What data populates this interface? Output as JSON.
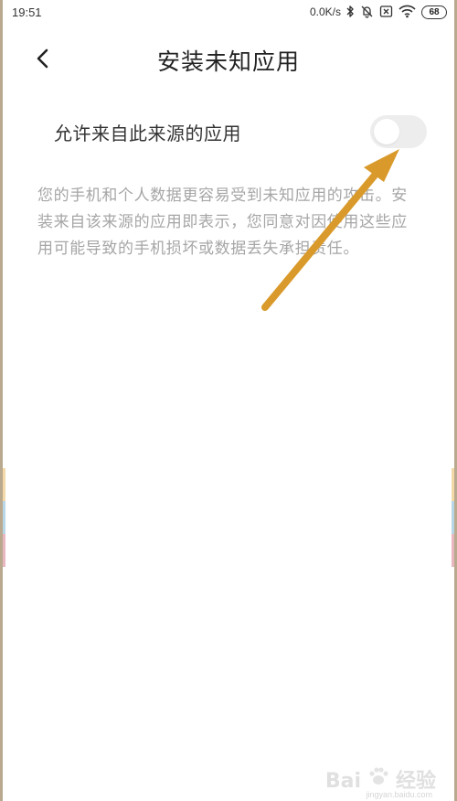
{
  "status_bar": {
    "time": "19:51",
    "network_speed": "0.0K/s",
    "battery": "68",
    "icons": [
      "bluetooth-icon",
      "bell-muted-icon",
      "sim-x-icon",
      "wifi-icon",
      "battery-icon"
    ]
  },
  "header": {
    "title": "安装未知应用",
    "back_icon": "chevron-left-icon"
  },
  "setting": {
    "label": "允许来自此来源的应用",
    "toggle_state": "off"
  },
  "description": "您的手机和个人数据更容易受到未知应用的攻击。安装来自该来源的应用即表示，您同意对因使用这些应用可能导致的手机损坏或数据丢失承担责任。",
  "annotation": {
    "color": "#d99a2b"
  },
  "watermark": {
    "brand": "Bai",
    "brand_tail": "经验",
    "url": "jingyan.baidu.com"
  },
  "colors": {
    "title": "#222222",
    "text": "#333333",
    "description": "#a6a6a6",
    "toggle_track": "#ededed",
    "frame_border": "#b9a98f"
  }
}
